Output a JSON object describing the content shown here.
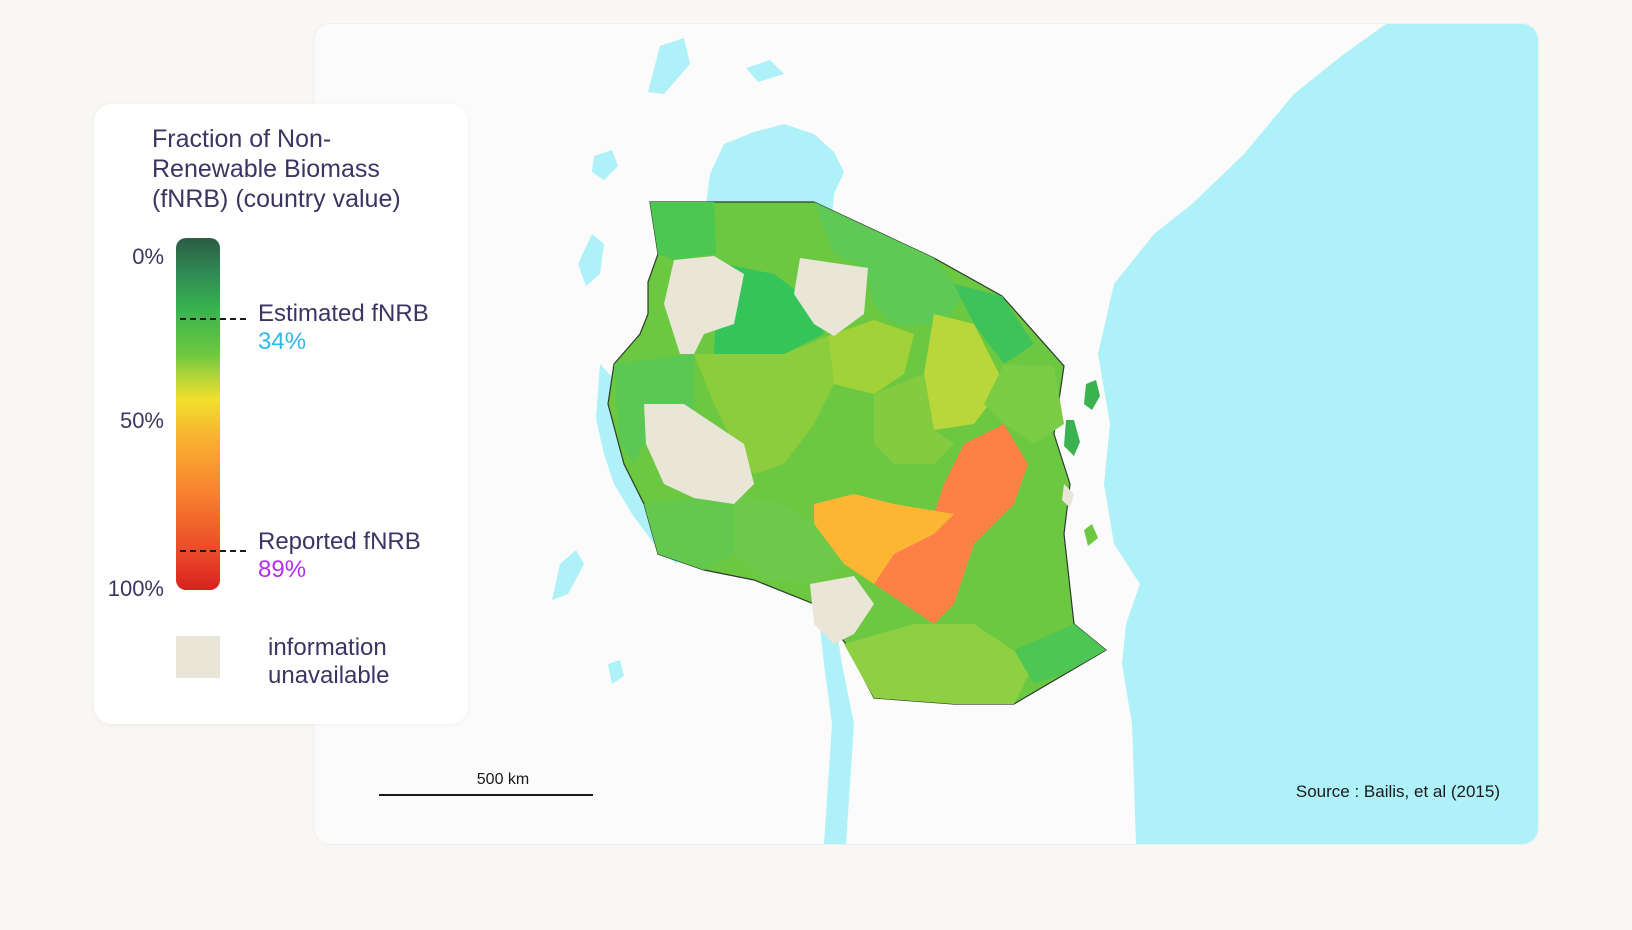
{
  "legend": {
    "title": "Fraction of Non-Renewable Biomass (fNRB) (country value)",
    "ticks": {
      "t0": "0%",
      "t50": "50%",
      "t100": "100%"
    },
    "estimated": {
      "label": "Estimated fNRB",
      "value": "34%",
      "fraction": 0.34,
      "color": "#2bb9e6"
    },
    "reported": {
      "label": "Reported fNRB",
      "value": "89%",
      "fraction": 0.89,
      "color": "#b42df0"
    },
    "unavailable": {
      "label": "information unavailable",
      "color": "#e9e6d8"
    },
    "gradient_colors": [
      "#2c5c45",
      "#39b24f",
      "#6cc840",
      "#f1e02c",
      "#f8822f",
      "#d8201f"
    ]
  },
  "map": {
    "scale_label": "500 km",
    "source": "Source : Bailis, et al (2015)",
    "water_color": "#aef1f8",
    "land_color": "#fbfbfb"
  }
}
